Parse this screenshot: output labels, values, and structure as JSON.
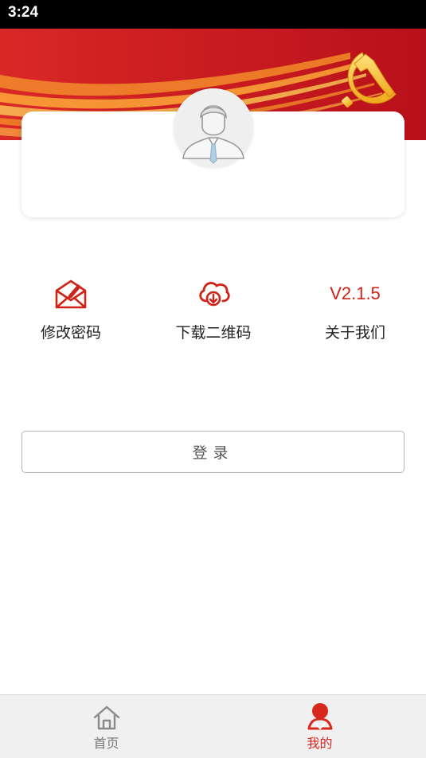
{
  "status_bar": {
    "time": "3:24"
  },
  "banner": {
    "emblem_icon": "party-emblem-icon",
    "colors": {
      "red": "#c8141c",
      "gold": "#f7c531"
    }
  },
  "profile": {
    "avatar_icon": "user-avatar-icon"
  },
  "actions": [
    {
      "label": "修改密码",
      "icon": "envelope-edit-icon",
      "color": "#cf2317"
    },
    {
      "label": "下载二维码",
      "icon": "cloud-download-icon",
      "color": "#cf2317"
    },
    {
      "label": "关于我们",
      "version": "V2.1.5",
      "color": "#cf2317"
    }
  ],
  "login": {
    "label": "登录"
  },
  "tabbar": {
    "tabs": [
      {
        "label": "首页",
        "icon": "home-icon",
        "active": false,
        "color": "#777777"
      },
      {
        "label": "我的",
        "icon": "user-icon",
        "active": true,
        "color": "#d8271d"
      }
    ]
  }
}
